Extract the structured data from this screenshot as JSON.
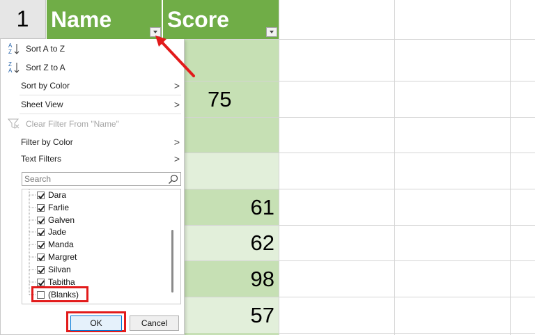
{
  "header": {
    "row_number": "1",
    "col_a": "Name",
    "col_b": "Score"
  },
  "scores": [
    "75",
    "61",
    "62",
    "98",
    "57"
  ],
  "menu": {
    "sort_az": "Sort A to Z",
    "sort_za": "Sort Z to A",
    "sort_by_color": "Sort by Color",
    "sheet_view": "Sheet View",
    "clear_filter": "Clear Filter From \"Name\"",
    "filter_by_color": "Filter by Color",
    "text_filters": "Text Filters",
    "search_placeholder": "Search",
    "chevron": ">",
    "items": [
      {
        "label": "Dara",
        "checked": true
      },
      {
        "label": "Farlie",
        "checked": true
      },
      {
        "label": "Galven",
        "checked": true
      },
      {
        "label": "Jade",
        "checked": true
      },
      {
        "label": "Manda",
        "checked": true
      },
      {
        "label": "Margret",
        "checked": true
      },
      {
        "label": "Silvan",
        "checked": true
      },
      {
        "label": "Tabitha",
        "checked": true
      },
      {
        "label": "(Blanks)",
        "checked": false
      }
    ],
    "ok_label": "OK",
    "cancel_label": "Cancel"
  },
  "colors": {
    "header_green": "#70ad47",
    "dark_band": "#c6e0b4",
    "light_band": "#e2efda",
    "highlight_red": "#e21b1b"
  },
  "icons": [
    "sort-az-icon",
    "sort-za-icon",
    "clear-filter-icon",
    "search-icon",
    "filter-dropdown-icon",
    "arrow-annotation"
  ]
}
